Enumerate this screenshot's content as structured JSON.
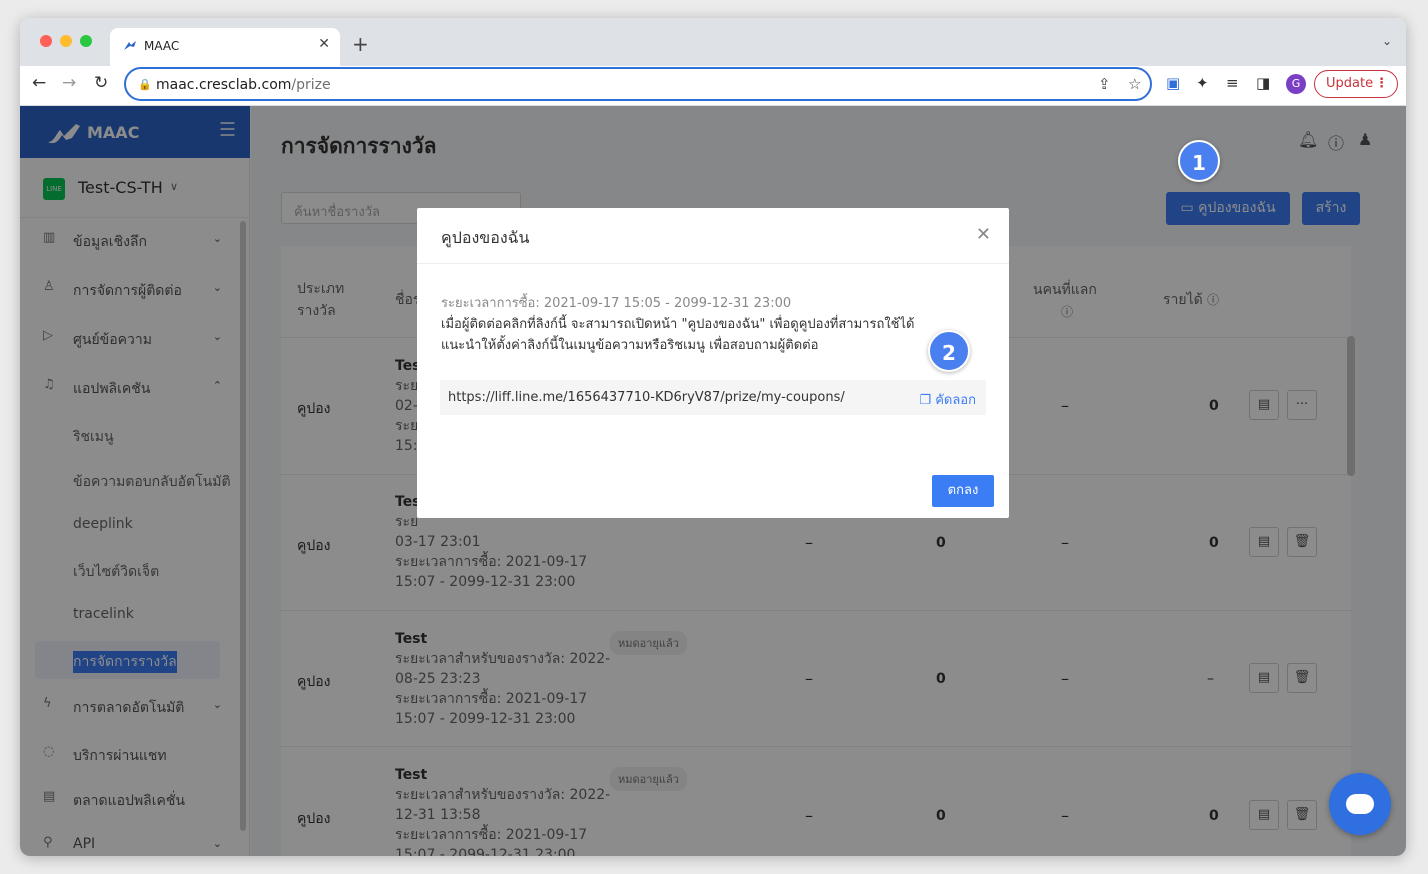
{
  "browser": {
    "tab_title": "MAAC",
    "url_host": "maac.cresclab.com",
    "url_path": "/prize",
    "profile_initial": "G",
    "update_label": "Update"
  },
  "sidebar": {
    "brand": "MAAC",
    "account": "Test-CS-TH",
    "menu": [
      {
        "label": "ข้อมูลเชิงลึก",
        "icon": "chart-icon"
      },
      {
        "label": "การจัดการผู้ติดต่อ",
        "icon": "user-icon"
      },
      {
        "label": "ศูนย์ข้อความ",
        "icon": "send-icon"
      },
      {
        "label": "แอปพลิเคชัน",
        "icon": "bell-icon"
      },
      {
        "label": "การตลาดอัตโนมัติ",
        "icon": "bolt-icon"
      },
      {
        "label": "บริการผ่านแชท",
        "icon": "chat-icon"
      },
      {
        "label": "ตลาดแอปพลิเคชั่น",
        "icon": "store-icon"
      },
      {
        "label": "API",
        "icon": "api-icon"
      }
    ],
    "subitems": [
      "ริชเมนู",
      "ข้อความตอบกลับอัตโนมัติ",
      "deeplink",
      "เว็บไซต์วิดเจ็ต",
      "tracelink",
      "การจัดการรางวัล"
    ]
  },
  "page": {
    "title": "การจัดการรางวัล",
    "search_placeholder": "ค้นหาชื่อรางวัล",
    "my_coupons_button": "คูปองของฉัน",
    "create_button": "สร้าง",
    "headers": {
      "type_line1": "ประเภท",
      "type_line2": "รางวัล",
      "name": "ชื่อร",
      "redeemers": "นคนที่แลก",
      "revenue": "รายได้"
    },
    "rows": [
      {
        "type": "คูปอง",
        "name": "Tes",
        "lines": [
          "ระย",
          "02-",
          "ระย",
          "15:"
        ],
        "revenue": "0"
      },
      {
        "type": "คูปอง",
        "name": "Tes",
        "lines": [
          "ระย",
          "03-17 23:01",
          "ระยะเวลาการซื้อ: 2021-09-17",
          "15:07 - 2099-12-31 23:00"
        ],
        "col3": "0",
        "revenue": "0"
      },
      {
        "type": "คูปอง",
        "name": "Test",
        "lines": [
          "ระยะเวลาสำหรับของรางวัล: 2022-",
          "08-25 23:23",
          "ระยะเวลาการซื้อ: 2021-09-17",
          "15:07 - 2099-12-31 23:00"
        ],
        "tag": "หมดอายุแล้ว",
        "col3": "0",
        "revenue": "–"
      },
      {
        "type": "คูปอง",
        "name": "Test",
        "lines": [
          "ระยะเวลาสำหรับของรางวัล: 2022-",
          "12-31 13:58",
          "ระยะเวลาการซื้อ: 2021-09-17",
          "15:07 - 2099-12-31 23:00"
        ],
        "tag": "หมดอายุแล้ว",
        "col3": "0",
        "revenue": "0"
      }
    ],
    "dash": "–"
  },
  "modal": {
    "title": "คูปองของฉัน",
    "period": "ระยะเวลาการซื้อ: 2021-09-17 15:05 - 2099-12-31 23:00",
    "desc_line1": "เมื่อผู้ติดต่อคลิกที่ลิงก์นี้ จะสามารถเปิดหน้า \"คูปองของฉัน\" เพื่อดูคูปองที่สามารถใช้ได้",
    "desc_line2": "แนะนำให้ตั้งค่าลิงก์นี้ในเมนูข้อความหรือริชเมนู เพื่อสอบถามผู้ติดต่อ",
    "link": "https://liff.line.me/1656437710-KD6ryV87/prize/my-coupons/",
    "copy_label": "คัดลอก",
    "ok_label": "ตกลง"
  },
  "badges": [
    "1",
    "2"
  ]
}
